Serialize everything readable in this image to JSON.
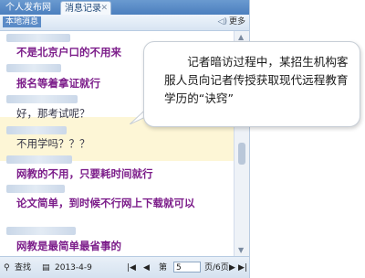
{
  "tabs": {
    "tab1": "个人发布网站",
    "tab2": "消息记录",
    "close": "✕"
  },
  "toolbar": {
    "local_label": "本地消息",
    "more_label": "更多"
  },
  "messages": [
    {
      "text": "不是北京户口的不用来",
      "style": "purple"
    },
    {
      "text": "报名等着拿证就行",
      "style": "purple"
    },
    {
      "text": "好，那考试呢？",
      "style": "grey"
    },
    {
      "text": "不用学吗？？？",
      "style": "grey"
    },
    {
      "text": "网教的不用，只要耗时间就行",
      "style": "purple"
    },
    {
      "text": "论文简单，到时候不行网上下载就可以",
      "style": "purple"
    },
    {
      "text": "网教是最简单最省事的",
      "style": "purple"
    }
  ],
  "bottom": {
    "search_label": "查找",
    "date": "2013-4-9",
    "page_prefix": "第",
    "page_value": "5",
    "page_suffix": "页/6页"
  },
  "callout": {
    "text": "记者暗访过程中，某招生机构客服人员向记者传授获取现代远程教育学历的“诀窍”"
  }
}
